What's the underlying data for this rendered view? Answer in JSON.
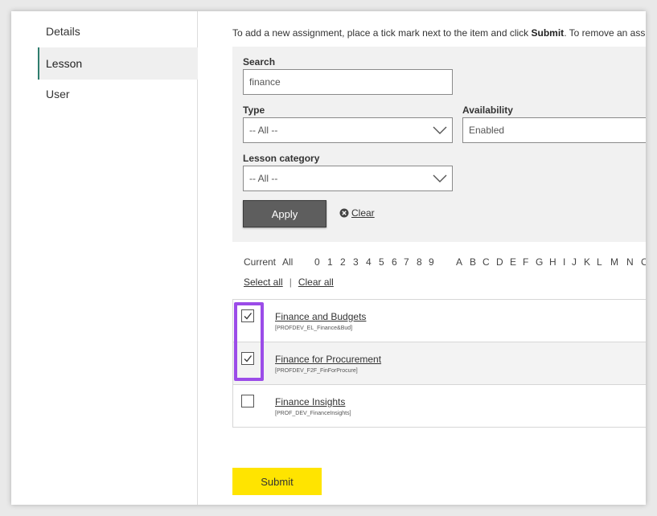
{
  "sidebar": {
    "items": [
      {
        "label": "Details",
        "active": false
      },
      {
        "label": "Lesson",
        "active": true
      },
      {
        "label": "User",
        "active": false
      }
    ]
  },
  "intro": {
    "text_before": "To add a new assignment, place a tick mark next to the item and click ",
    "bold": "Submit",
    "text_after": ". To remove an assignme"
  },
  "filters": {
    "search_label": "Search",
    "search_value": "finance",
    "type_label": "Type",
    "type_value": "-- All --",
    "availability_label": "Availability",
    "availability_value": "Enabled",
    "category_label": "Lesson category",
    "category_value": "-- All --",
    "apply_label": "Apply",
    "clear_label": "Clear"
  },
  "alphabet": {
    "current": "Current",
    "all": "All",
    "digits": [
      "0",
      "1",
      "2",
      "3",
      "4",
      "5",
      "6",
      "7",
      "8",
      "9"
    ],
    "letters": [
      "A",
      "B",
      "C",
      "D",
      "E",
      "F",
      "G",
      "H",
      "I",
      "J",
      "K",
      "L",
      "M",
      "N",
      "O"
    ]
  },
  "selection": {
    "select_all": "Select all",
    "separator": "|",
    "clear_all": "Clear all"
  },
  "lessons": [
    {
      "title": "Finance and Budgets",
      "code": "[PROFDEV_EL_Finance&Bud]",
      "checked": true
    },
    {
      "title": "Finance for Procurement",
      "code": "[PROFDEV_F2F_FinForProcure]",
      "checked": true
    },
    {
      "title": "Finance Insights",
      "code": "[PROF_DEV_FinanceInsights]",
      "checked": false
    }
  ],
  "submit_label": "Submit",
  "colors": {
    "highlight": "#9b4ce8",
    "submit": "#ffe400",
    "apply": "#5e5e5e",
    "active_border": "#2f7d6e"
  }
}
